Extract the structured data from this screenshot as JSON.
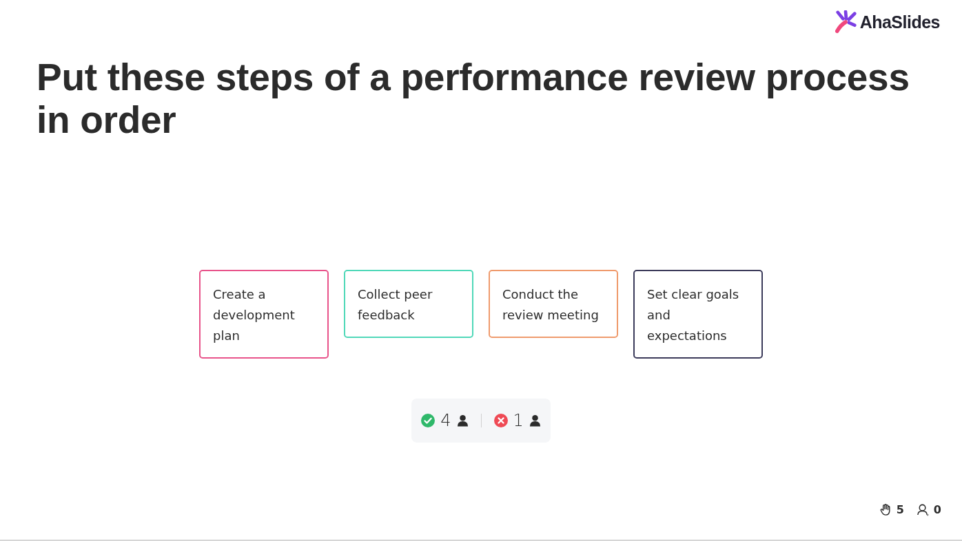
{
  "logo": {
    "text": "AhaSlides"
  },
  "title": "Put these steps of a performance review process in order",
  "items": [
    {
      "text": "Create a development plan",
      "color": "#e8538a"
    },
    {
      "text": "Collect peer feedback",
      "color": "#4fd8b8"
    },
    {
      "text": "Conduct the review meeting",
      "color": "#ef9a6c"
    },
    {
      "text": "Set clear goals and expectations",
      "color": "#3b3a5a"
    }
  ],
  "results": {
    "correct": "4",
    "incorrect": "1"
  },
  "footer": {
    "reactions": "5",
    "audience": "0"
  }
}
